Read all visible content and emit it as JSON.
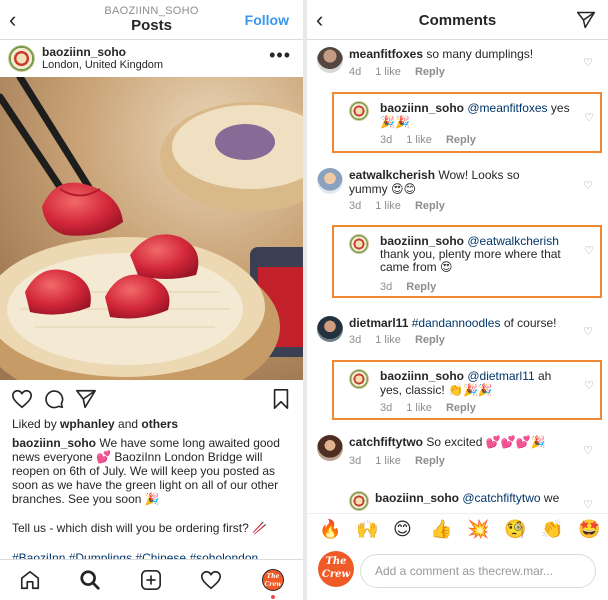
{
  "post": {
    "header": {
      "account": "BAOZIINN_SOHO",
      "title": "Posts",
      "follow": "Follow"
    },
    "author": "baoziinn_soho",
    "location": "London, United Kingdom",
    "likes": {
      "prefix": "Liked by ",
      "user": "wphanley",
      "and": " and ",
      "others": "others"
    },
    "caption": {
      "author": "baoziinn_soho",
      "body": " We have some long awaited good news everyone 💕 BaoziInn London Bridge will reopen on 6th of July. We will keep you posted as soon as we have the green light on all of our other branches. See you soon 🎉",
      "question": "Tell us - which dish will you be ordering first? 🥢",
      "hashtags": "#BaoziInn #Dumplings #Chinese #soholondon"
    },
    "nav": {
      "profile_logo": "The Crew"
    }
  },
  "comments_panel": {
    "title": "Comments",
    "comments": [
      {
        "user": "meanfitfoxes",
        "mention": "",
        "text": " so many dumplings!",
        "age": "4d",
        "likes": "1 like",
        "reply": "Reply"
      },
      {
        "user": "baoziinn_soho",
        "mention": "@meanfitfoxes",
        "text": " yes 🎉🎉",
        "age": "3d",
        "likes": "1 like",
        "reply": "Reply"
      },
      {
        "user": "eatwalkcherish",
        "mention": "",
        "text": " Wow! Looks so yummy 😍😊",
        "age": "3d",
        "likes": "1 like",
        "reply": "Reply"
      },
      {
        "user": "baoziinn_soho",
        "mention": "@eatwalkcherish",
        "text": " thank you, plenty more where that came from 😍",
        "age": "3d",
        "likes": "",
        "reply": "Reply"
      },
      {
        "user": "dietmarl11",
        "mention": "#dandannoodles",
        "text": " of course!",
        "age": "3d",
        "likes": "1 like",
        "reply": "Reply"
      },
      {
        "user": "baoziinn_soho",
        "mention": "@dietmarl11",
        "text": " ah yes, classic! 👏🎉🎉",
        "age": "3d",
        "likes": "1 like",
        "reply": "Reply"
      },
      {
        "user": "catchfiftytwo",
        "mention": "",
        "text": " So excited 💕💕💕🎉",
        "age": "3d",
        "likes": "1 like",
        "reply": "Reply"
      },
      {
        "user": "baoziinn_soho",
        "mention": "@catchfiftytwo",
        "text": " we",
        "age": "",
        "likes": "",
        "reply": ""
      }
    ],
    "emojis": [
      "🔥",
      "🙌",
      "😊",
      "👍",
      "💥",
      "🧐",
      "👏",
      "🤩"
    ],
    "composer": {
      "placeholder": "Add a comment as thecrew.mar...",
      "avatar_logo": "The Crew"
    }
  },
  "colors": {
    "link_blue": "#3897f0",
    "mention_blue": "#003569",
    "highlight_orange": "#f08833",
    "crew_orange": "#ef5a26"
  }
}
